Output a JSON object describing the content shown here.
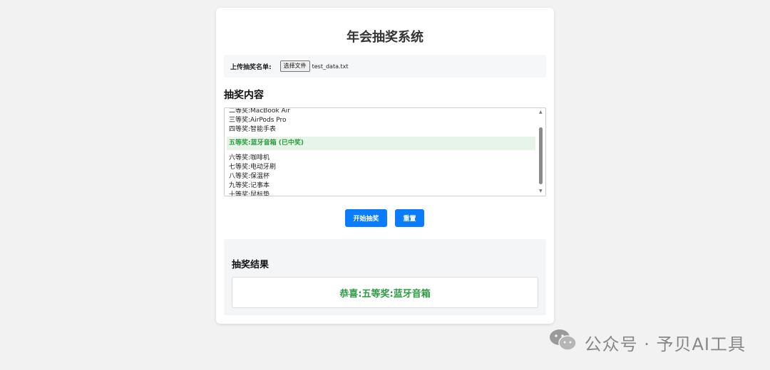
{
  "app": {
    "title": "年会抽奖系统"
  },
  "upload": {
    "label": "上传抽奖名单:",
    "button_label": "选择文件",
    "file_name": "test_data.txt"
  },
  "prizes": {
    "section_title": "抽奖内容",
    "items": [
      {
        "label": "二等奖:MacBook Air"
      },
      {
        "label": "三等奖:AirPods Pro"
      },
      {
        "label": "四等奖:智能手表"
      },
      {
        "label": "五等奖:蓝牙音箱 (已中奖)",
        "won": true
      },
      {
        "label": "六等奖:咖啡机"
      },
      {
        "label": "七等奖:电动牙刷"
      },
      {
        "label": "八等奖:保温杯"
      },
      {
        "label": "九等奖:记事本"
      },
      {
        "label": "十等奖:鼠标垫"
      }
    ]
  },
  "actions": {
    "start_label": "开始抽奖",
    "reset_label": "重置"
  },
  "result": {
    "title": "抽奖结果",
    "message": "恭喜:五等奖:蓝牙音箱"
  },
  "watermark": {
    "text": "公众号 · 予贝AI工具"
  },
  "colors": {
    "accent": "#0a7cff",
    "success": "#2e9b44",
    "highlight_bg": "#e7f4e8",
    "background": "#f2f2f2"
  },
  "icons": {
    "scroll_up": "triangle-up",
    "scroll_down": "triangle-down",
    "watermark": "wechat-icon"
  }
}
